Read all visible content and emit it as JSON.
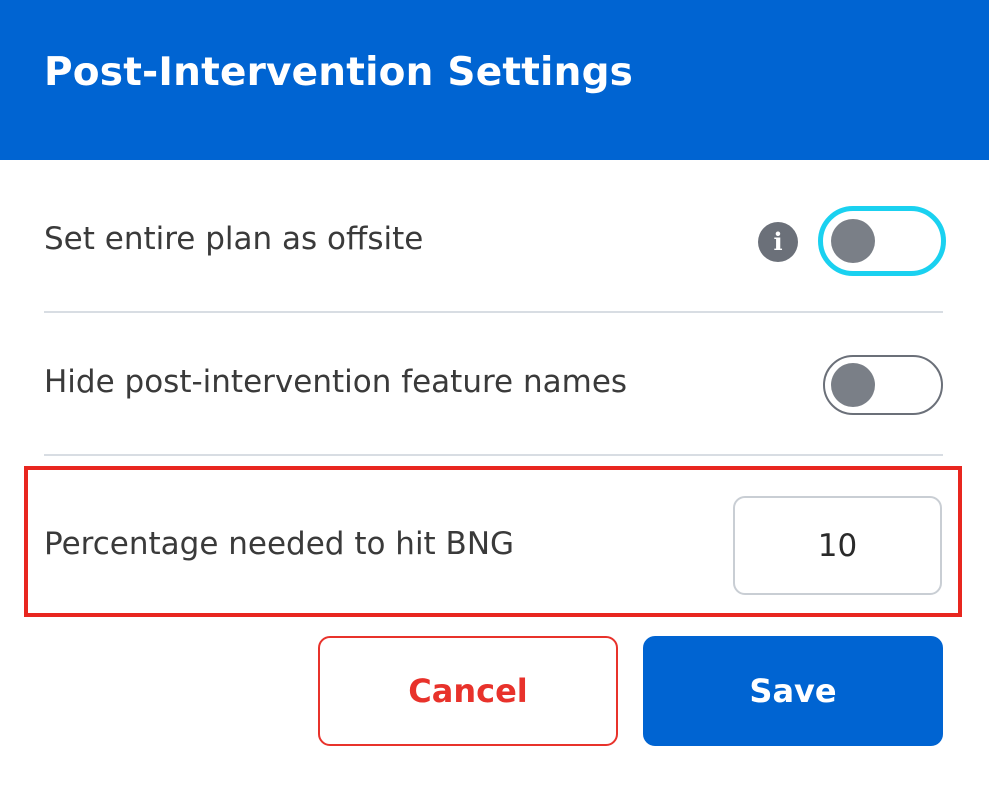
{
  "dialog": {
    "title": "Post-Intervention Settings"
  },
  "settings": {
    "offsite": {
      "label": "Set entire plan as offsite",
      "info_icon": "info-icon",
      "enabled": false
    },
    "hide_names": {
      "label": "Hide post-intervention feature names",
      "enabled": false
    },
    "bng_percentage": {
      "label": "Percentage needed to hit BNG",
      "value": "10"
    }
  },
  "actions": {
    "cancel_label": "Cancel",
    "save_label": "Save"
  },
  "colors": {
    "primary": "#0064d2",
    "danger": "#e8322b",
    "focus_ring": "#1ad1f0",
    "highlight": "#e8261f"
  }
}
